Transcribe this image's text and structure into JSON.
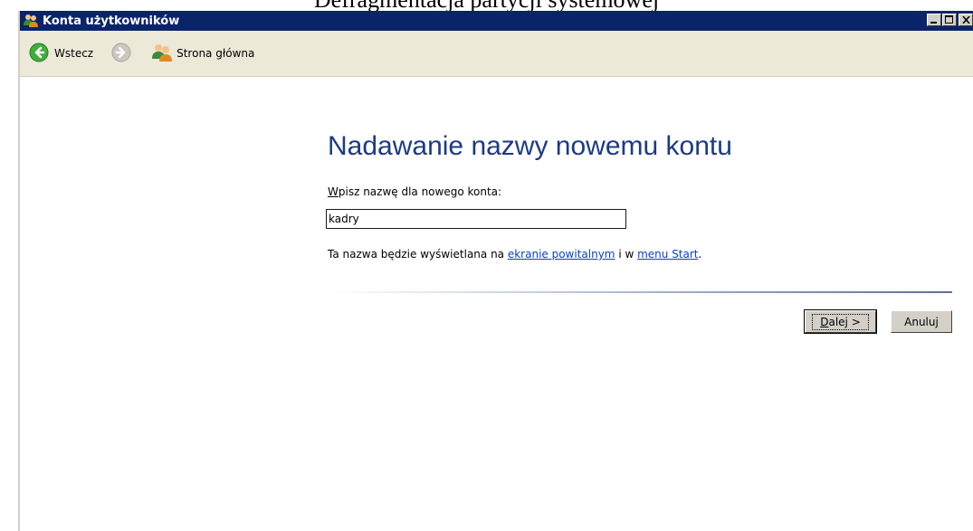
{
  "document": {
    "heading": "Defragmentacja partycji systemowej"
  },
  "window": {
    "title": "Konta użytkowników",
    "icon": "users-icon",
    "controls": [
      "minimize-icon",
      "maximize-icon",
      "close-icon"
    ]
  },
  "toolbar": {
    "back_label": "Wstecz",
    "home_label": "Strona główna"
  },
  "main": {
    "title": "Nadawanie nazwy nowemu kontu",
    "field_label_accel": "W",
    "field_label_rest": "pisz nazwę dla nowego konta:",
    "name_value": "kadry",
    "info_prefix": "Ta nazwa będzie wyświetlana na ",
    "info_link1": "ekranie powitalnym",
    "info_middle": " i w ",
    "info_link2": "menu Start",
    "info_suffix": "."
  },
  "buttons": {
    "next_accel": "D",
    "next_rest": "alej >",
    "cancel_label": "Anuluj"
  },
  "colors": {
    "titlebar": "#0a246a",
    "page_title": "#1c3a85",
    "link": "#0b41c5",
    "toolbar_bg": "#ece9d8"
  }
}
